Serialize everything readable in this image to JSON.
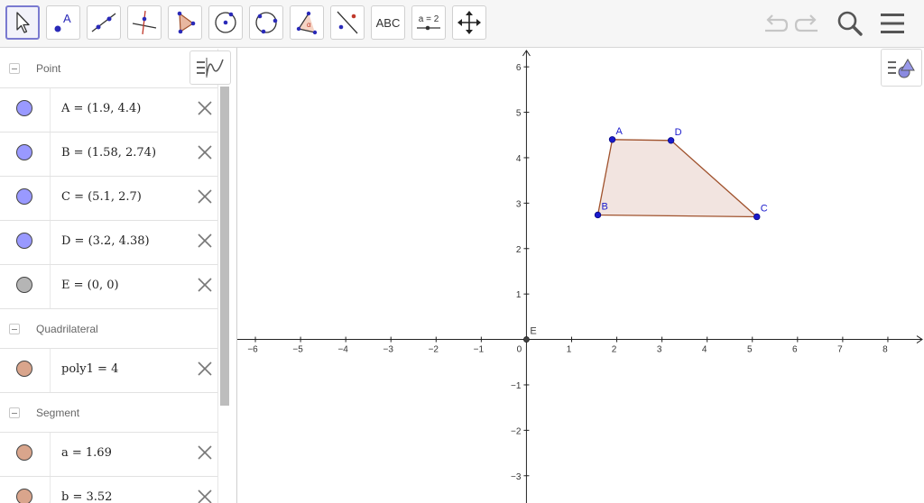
{
  "toolbar": {
    "tools": [
      {
        "name": "move-tool",
        "icon": "arrow-cursor-icon",
        "active": true
      },
      {
        "name": "point-tool",
        "icon": "point-icon",
        "label": "A"
      },
      {
        "name": "line-tool",
        "icon": "line-icon"
      },
      {
        "name": "perpendicular-line-tool",
        "icon": "perpendicular-line-icon"
      },
      {
        "name": "polygon-tool",
        "icon": "polygon-icon"
      },
      {
        "name": "circle-center-point-tool",
        "icon": "circle-center-icon"
      },
      {
        "name": "circle-three-points-tool",
        "icon": "circle-three-points-icon"
      },
      {
        "name": "angle-tool",
        "icon": "angle-icon",
        "label": "α"
      },
      {
        "name": "reflect-tool",
        "icon": "reflect-icon"
      },
      {
        "name": "text-tool",
        "icon": "text-icon",
        "label": "ABC"
      },
      {
        "name": "slider-tool",
        "icon": "slider-icon",
        "label": "a = 2"
      },
      {
        "name": "move-graphics-view-tool",
        "icon": "move-arrows-icon"
      }
    ],
    "right": [
      {
        "name": "undo-button",
        "icon": "undo-icon"
      },
      {
        "name": "redo-button",
        "icon": "redo-icon"
      },
      {
        "name": "search-button",
        "icon": "search-icon"
      },
      {
        "name": "main-menu-button",
        "icon": "hamburger-menu-icon"
      }
    ]
  },
  "algebra": {
    "groups": [
      {
        "title": "Point",
        "items": [
          {
            "text": "A = (1.9, 4.4)",
            "color": "#9999ff"
          },
          {
            "text": "B = (1.58, 2.74)",
            "color": "#9999ff"
          },
          {
            "text": "C = (5.1, 2.7)",
            "color": "#9999ff"
          },
          {
            "text": "D = (3.2, 4.38)",
            "color": "#9999ff"
          },
          {
            "text": "E = (0, 0)",
            "color": "#b5b5b5"
          }
        ]
      },
      {
        "title": "Quadrilateral",
        "items": [
          {
            "text": "poly1 = 4",
            "color": "#d9a58c"
          }
        ]
      },
      {
        "title": "Segment",
        "items": [
          {
            "text": "a = 1.69",
            "color": "#d9a58c"
          },
          {
            "text": "b = 3.52",
            "color": "#d9a58c"
          }
        ]
      }
    ]
  },
  "graphics": {
    "x_ticks": [
      "−6",
      "−5",
      "−4",
      "−3",
      "−2",
      "−1",
      "0",
      "1",
      "2",
      "3",
      "4",
      "5",
      "6",
      "7",
      "8"
    ],
    "y_ticks": [
      "6",
      "5",
      "4",
      "3",
      "2",
      "1",
      "−1",
      "−2",
      "−3"
    ],
    "x_range": [
      -6.4,
      8.8
    ],
    "y_range": [
      -3.6,
      6.4
    ],
    "points": [
      {
        "label": "A",
        "x": 1.9,
        "y": 4.4
      },
      {
        "label": "B",
        "x": 1.58,
        "y": 2.74
      },
      {
        "label": "C",
        "x": 5.1,
        "y": 2.7
      },
      {
        "label": "D",
        "x": 3.2,
        "y": 4.38
      }
    ],
    "origin_point": {
      "label": "E",
      "x": 0,
      "y": 0
    },
    "polygon": [
      "A",
      "B",
      "C",
      "D"
    ],
    "colors": {
      "point": "#1a1acc",
      "polygon_stroke": "#a0522d",
      "polygon_fill": "#f2e4e0",
      "axis": "#222222"
    }
  }
}
